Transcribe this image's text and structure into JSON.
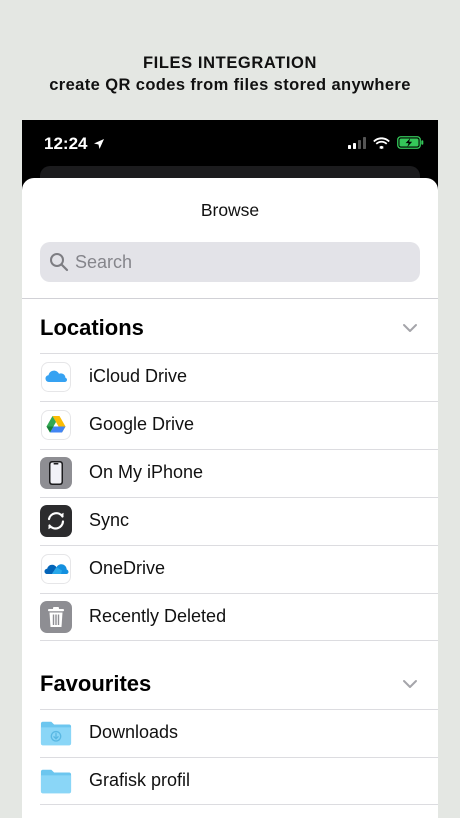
{
  "promo": {
    "line1": "FILES INTEGRATION",
    "line2": "create QR codes from files stored anywhere"
  },
  "status_bar": {
    "time": "12:24"
  },
  "sheet": {
    "title": "Browse",
    "search_placeholder": "Search"
  },
  "locations": {
    "title": "Locations",
    "items": [
      {
        "label": "iCloud Drive",
        "icon": "icloud-icon"
      },
      {
        "label": "Google Drive",
        "icon": "google-drive-icon"
      },
      {
        "label": "On My iPhone",
        "icon": "iphone-icon"
      },
      {
        "label": "Sync",
        "icon": "sync-icon"
      },
      {
        "label": "OneDrive",
        "icon": "onedrive-icon"
      },
      {
        "label": "Recently Deleted",
        "icon": "trash-icon"
      }
    ]
  },
  "favourites": {
    "title": "Favourites",
    "items": [
      {
        "label": "Downloads",
        "icon": "downloads-folder-icon"
      },
      {
        "label": "Grafisk profil",
        "icon": "folder-icon"
      }
    ]
  },
  "colors": {
    "background": "#e4e7e3",
    "ios_blue": "#1a8cff",
    "folder_blue": "#7fd0f5",
    "search_bg": "#e3e3e8",
    "battery_green": "#34c759"
  }
}
